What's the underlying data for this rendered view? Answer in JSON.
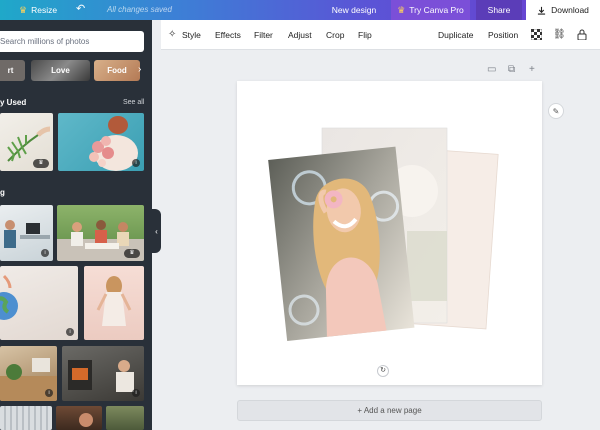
{
  "topbar": {
    "resize_label": "Resize",
    "undo_icon": "undo-icon",
    "saved_status": "All changes saved",
    "new_design_label": "New design",
    "try_pro_label": "Try Canva Pro",
    "share_label": "Share",
    "download_label": "Download"
  },
  "sidebar": {
    "search_placeholder": "Search millions of photos",
    "chips": [
      "rt",
      "Love",
      "Food"
    ],
    "recently_used_title": "y Used",
    "see_all_label": "See all",
    "second_section_title": "g"
  },
  "toolbar": {
    "style": "Style",
    "effects": "Effects",
    "filter": "Filter",
    "adjust": "Adjust",
    "crop": "Crop",
    "flip": "Flip",
    "duplicate": "Duplicate",
    "position": "Position"
  },
  "canvas": {
    "add_page_label": "+ Add a new page"
  },
  "colors": {
    "brand_gradient_start": "#1fa8c9",
    "brand_gradient_end": "#6b3fd0",
    "panel_bg": "#293039",
    "workspace_bg": "#eceef1"
  }
}
